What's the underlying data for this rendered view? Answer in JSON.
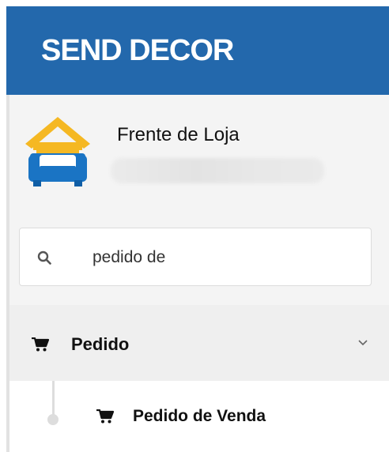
{
  "header": {
    "title": "SEND DECOR",
    "background": "#2368ac"
  },
  "profile": {
    "store_name": "Frente de Loja",
    "avatar_icon": "armchair-house-icon"
  },
  "search": {
    "icon": "search-icon",
    "value": "pedido de"
  },
  "menu": {
    "items": [
      {
        "label": "Pedido",
        "icon": "shopping-cart-icon",
        "expanded": true,
        "children": [
          {
            "label": "Pedido de Venda",
            "icon": "shopping-cart-icon"
          }
        ]
      }
    ]
  }
}
